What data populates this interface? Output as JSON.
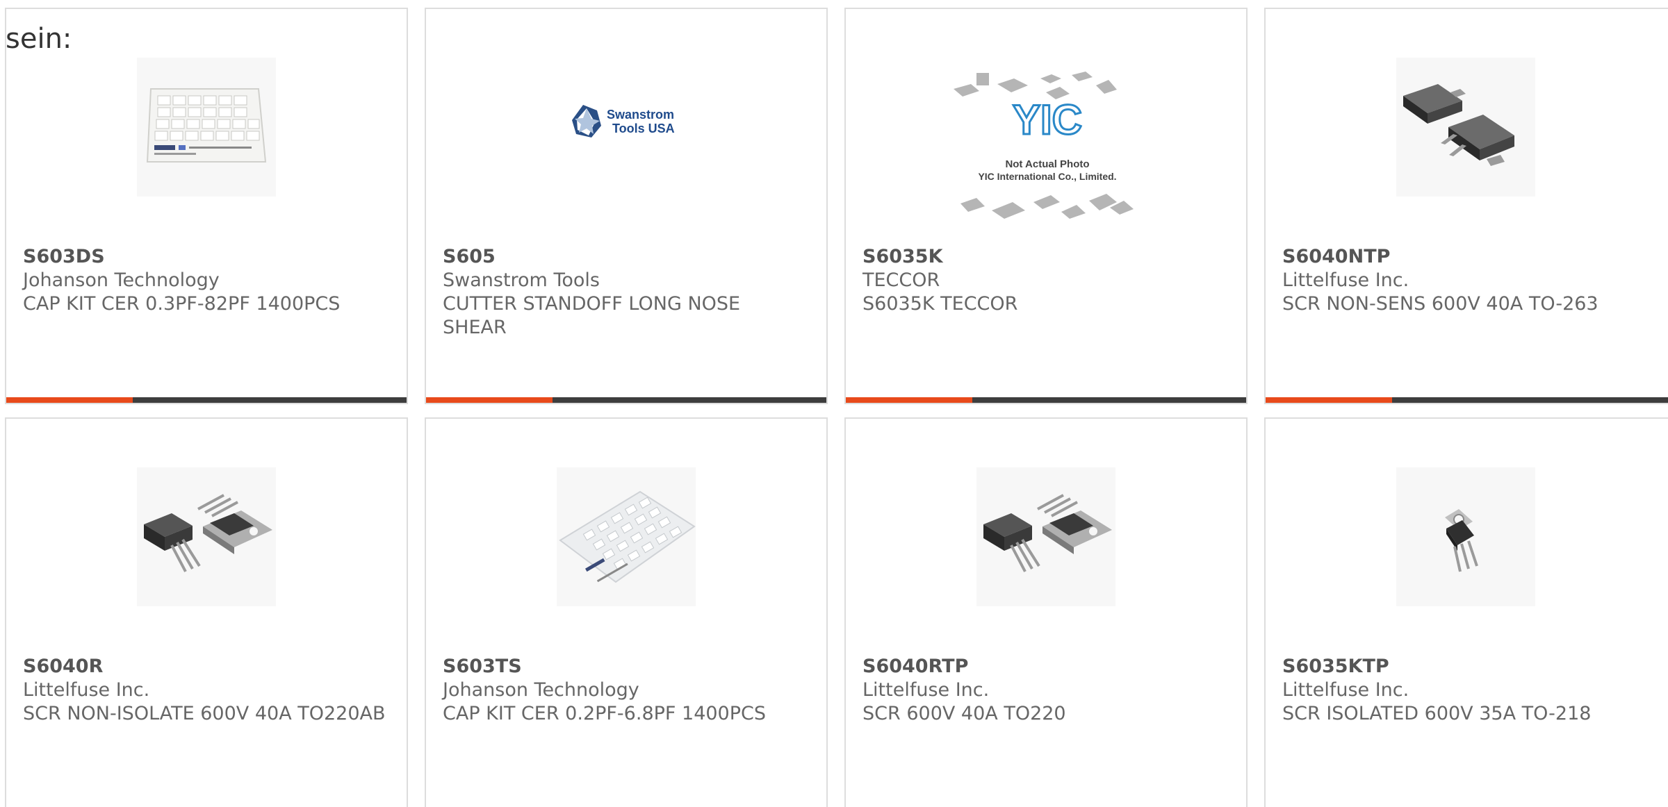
{
  "intro_text": "sein:",
  "colors": {
    "accent": "#e84a1b",
    "bar": "#3d3d3d",
    "border": "#dddddd",
    "text": "#666666"
  },
  "products": [
    {
      "part_number": "S603DS",
      "manufacturer": "Johanson Technology",
      "description": "CAP KIT CER 0.3PF-82PF 1400PCS",
      "image_icon": "capacitor-kit-icon"
    },
    {
      "part_number": "S605",
      "manufacturer": "Swanstrom Tools",
      "description": "CUTTER STANDOFF LONG NOSE SHEAR",
      "image_icon": "swanstrom-logo",
      "logo_text_1": "Swanstrom",
      "logo_text_2": "Tools USA"
    },
    {
      "part_number": "S6035K",
      "manufacturer": "TECCOR",
      "description": "S6035K TECCOR",
      "image_icon": "not-actual-photo-icon",
      "logo_text_1": "YIC",
      "logo_text_2": "Not Actual Photo",
      "logo_text_3": "YIC International Co., Limited."
    },
    {
      "part_number": "S6040NTP",
      "manufacturer": "Littelfuse Inc.",
      "description": "SCR NON-SENS 600V 40A TO-263",
      "image_icon": "to263-package-icon"
    },
    {
      "part_number": "S6040R",
      "manufacturer": "Littelfuse Inc.",
      "description": "SCR NON-ISOLATE 600V 40A TO220AB",
      "image_icon": "to220-package-icon"
    },
    {
      "part_number": "S603TS",
      "manufacturer": "Johanson Technology",
      "description": "CAP KIT CER 0.2PF-6.8PF 1400PCS",
      "image_icon": "capacitor-kit-icon"
    },
    {
      "part_number": "S6040RTP",
      "manufacturer": "Littelfuse Inc.",
      "description": "SCR 600V 40A TO220",
      "image_icon": "to220-package-icon"
    },
    {
      "part_number": "S6035KTP",
      "manufacturer": "Littelfuse Inc.",
      "description": "SCR ISOLATED 600V 35A TO-218",
      "image_icon": "to218-package-icon"
    }
  ]
}
